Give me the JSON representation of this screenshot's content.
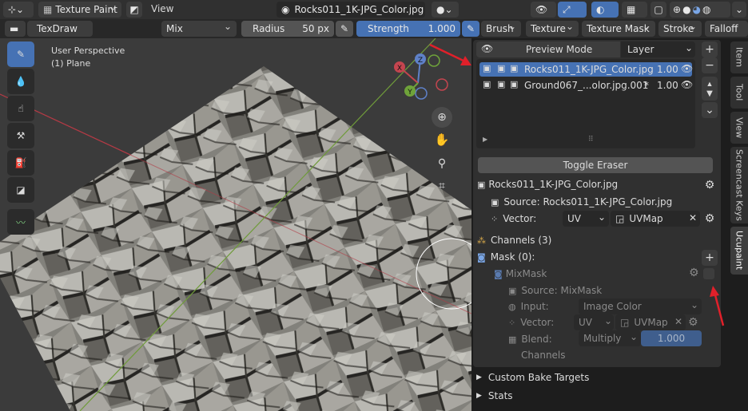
{
  "header": {
    "mode": "Texture Paint",
    "view": "View",
    "image_name": "Rocks011_1K-JPG_Color.jpg"
  },
  "toolbar": {
    "brush_name": "TexDraw",
    "blend": "Mix",
    "radius_label": "Radius",
    "radius_value": "50 px",
    "strength_label": "Strength",
    "strength_value": "1.000",
    "brush": "Brush",
    "texture": "Texture",
    "texture_mask": "Texture Mask",
    "stroke": "Stroke",
    "falloff": "Falloff"
  },
  "viewport": {
    "perspective": "User Perspective",
    "object": "(1) Plane",
    "axis_x": "X",
    "axis_y": "Y",
    "axis_z": "Z"
  },
  "panel": {
    "tab_preview": "Preview Mode",
    "tab_layer": "Layer",
    "layers": [
      {
        "name": "Rocks011_1K-JPG_Color.jpg",
        "value": "1.00",
        "mark": ""
      },
      {
        "name": "Ground067_...olor.jpg.001",
        "value": "1.00",
        "mark": "*"
      }
    ],
    "toggle_eraser": "Toggle Eraser",
    "image_label": "Rocks011_1K-JPG_Color.jpg",
    "source_label": "Source: Rocks011_1K-JPG_Color.jpg",
    "vector_label": "Vector:",
    "vector_type": "UV",
    "uvmap": "UVMap",
    "channels": "Channels (3)",
    "mask": "Mask (0):",
    "mixmask": "MixMask",
    "mix_source": "Source: MixMask",
    "input_label": "Input:",
    "input_value": "Image Color",
    "mix_vector_label": "Vector:",
    "mix_vector_type": "UV",
    "mix_uvmap": "UVMap",
    "blend_label": "Blend:",
    "blend_value": "Multiply",
    "blend_amount": "1.000",
    "mix_channels": "Channels",
    "custom_bake": "Custom Bake Targets",
    "stats": "Stats"
  },
  "side_tabs": [
    "Item",
    "Tool",
    "View",
    "Screencast Keys",
    "Ucupaint"
  ],
  "colors": {
    "accent": "#4672b4",
    "annotation_arrow": "#e0202a"
  }
}
